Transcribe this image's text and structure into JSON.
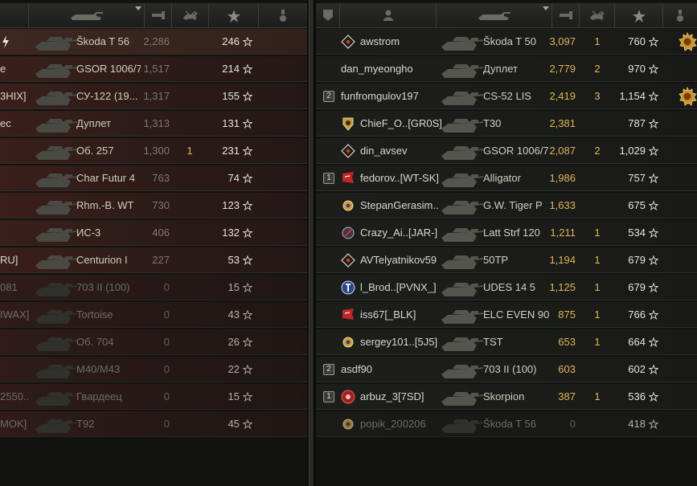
{
  "left_team": [
    {
      "name": "",
      "vehicle": "Škoda T 56",
      "damage": "2,286",
      "kills": "",
      "xp": "246",
      "self": true
    },
    {
      "name": "e",
      "vehicle": "GSOR 1006/7",
      "damage": "1,517",
      "kills": "",
      "xp": "214"
    },
    {
      "name": "3HIX]",
      "vehicle": "СУ-122 (19...",
      "damage": "1,317",
      "kills": "",
      "xp": "155"
    },
    {
      "name": "ec",
      "vehicle": "Дуплет",
      "damage": "1,313",
      "kills": "",
      "xp": "131"
    },
    {
      "name": "",
      "vehicle": "Об. 257",
      "damage": "1,300",
      "kills": "1",
      "xp": "231"
    },
    {
      "name": "",
      "vehicle": "Char Futur 4",
      "damage": "763",
      "kills": "",
      "xp": "74"
    },
    {
      "name": "",
      "vehicle": "Rhm.-B. WT",
      "damage": "730",
      "kills": "",
      "xp": "123"
    },
    {
      "name": "",
      "vehicle": "ИС-3",
      "damage": "406",
      "kills": "",
      "xp": "132"
    },
    {
      "name": "RU]",
      "vehicle": "Centurion I",
      "damage": "227",
      "kills": "",
      "xp": "53"
    },
    {
      "name": "081",
      "vehicle": "703 II (100)",
      "damage": "0",
      "kills": "",
      "xp": "15"
    },
    {
      "name": "IWAX]",
      "vehicle": "Tortoise",
      "damage": "0",
      "kills": "",
      "xp": "43"
    },
    {
      "name": "",
      "vehicle": "Об. 704",
      "damage": "0",
      "kills": "",
      "xp": "26"
    },
    {
      "name": "",
      "vehicle": "M40/M43",
      "damage": "0",
      "kills": "",
      "xp": "22"
    },
    {
      "name": "2550..",
      "vehicle": "Гвардеец",
      "damage": "0",
      "kills": "",
      "xp": "15"
    },
    {
      "name": "MOK]",
      "vehicle": "T92",
      "damage": "0",
      "kills": "",
      "xp": "45"
    }
  ],
  "right_team": [
    {
      "platoon": "",
      "emblem": "diamond",
      "name": "awstrom",
      "vehicle": "Škoda T 50",
      "damage": "3,097",
      "kills": "1",
      "xp": "760",
      "medal": true
    },
    {
      "platoon": "",
      "emblem": "",
      "name": "dan_myeongho",
      "vehicle": "Дуплет",
      "damage": "2,779",
      "kills": "2",
      "xp": "970",
      "medal": false
    },
    {
      "platoon": "2",
      "emblem": "",
      "name": "funfromgulov197",
      "vehicle": "CS-52 LIS",
      "damage": "2,419",
      "kills": "3",
      "xp": "1,154",
      "medal": true
    },
    {
      "platoon": "",
      "emblem": "shield",
      "name": "ChieF_O..[GR0S]",
      "vehicle": "T30",
      "damage": "2,381",
      "kills": "",
      "xp": "787",
      "medal": false
    },
    {
      "platoon": "",
      "emblem": "diamond3",
      "name": "din_avsev",
      "vehicle": "GSOR 1006/7",
      "damage": "2,087",
      "kills": "2",
      "xp": "1,029",
      "medal": false
    },
    {
      "platoon": "1",
      "emblem": "flag",
      "name": "fedorov..[WT-SK]",
      "vehicle": "Alligator",
      "damage": "1,986",
      "kills": "",
      "xp": "757",
      "medal": false
    },
    {
      "platoon": "",
      "emblem": "gear",
      "name": "StepanGerasim..",
      "vehicle": "G.W. Tiger P",
      "damage": "1,633",
      "kills": "",
      "xp": "675",
      "medal": false
    },
    {
      "platoon": "",
      "emblem": "cross",
      "name": "Crazy_Ai..[JAR-]",
      "vehicle": "Latt Strf 120",
      "damage": "1,211",
      "kills": "1",
      "xp": "534",
      "medal": false
    },
    {
      "platoon": "",
      "emblem": "diamond",
      "name": "AVTelyatnikov59",
      "vehicle": "50TP",
      "damage": "1,194",
      "kills": "1",
      "xp": "679",
      "medal": false
    },
    {
      "platoon": "",
      "emblem": "circle",
      "name": "l_Brod..[PVNX_]",
      "vehicle": "UDES 14 5",
      "damage": "1,125",
      "kills": "1",
      "xp": "679",
      "medal": false
    },
    {
      "platoon": "",
      "emblem": "flag",
      "name": "iss67[_BLK]",
      "vehicle": "ELC EVEN 90",
      "damage": "875",
      "kills": "1",
      "xp": "766",
      "medal": false
    },
    {
      "platoon": "",
      "emblem": "gear",
      "name": "sergey101..[5J5]",
      "vehicle": "TST",
      "damage": "653",
      "kills": "1",
      "xp": "664",
      "medal": false
    },
    {
      "platoon": "2",
      "emblem": "",
      "name": "asdf90",
      "vehicle": "703 II (100)",
      "damage": "603",
      "kills": "",
      "xp": "602",
      "medal": false
    },
    {
      "platoon": "1",
      "emblem": "redcircle",
      "name": "arbuz_3[7SD]",
      "vehicle": "Skorpion",
      "damage": "387",
      "kills": "1",
      "xp": "536",
      "medal": false
    },
    {
      "platoon": "",
      "emblem": "gear",
      "name": "popik_200206",
      "vehicle": "Škoda T 56",
      "damage": "0",
      "kills": "",
      "xp": "418",
      "medal": false,
      "dead": true
    }
  ],
  "colors": {
    "enemy_row": "#3a1f1b",
    "ally_row": "#1d1e1b",
    "damage": "#e0b55a",
    "accent": "#a8a89c"
  },
  "icons": [
    "platoon-header-icon",
    "player-header-icon",
    "vehicle-header-icon",
    "damage-header-icon",
    "kills-header-icon",
    "xp-header-icon",
    "medal-header-icon",
    "star-icon",
    "tank-silhouette-icon"
  ]
}
